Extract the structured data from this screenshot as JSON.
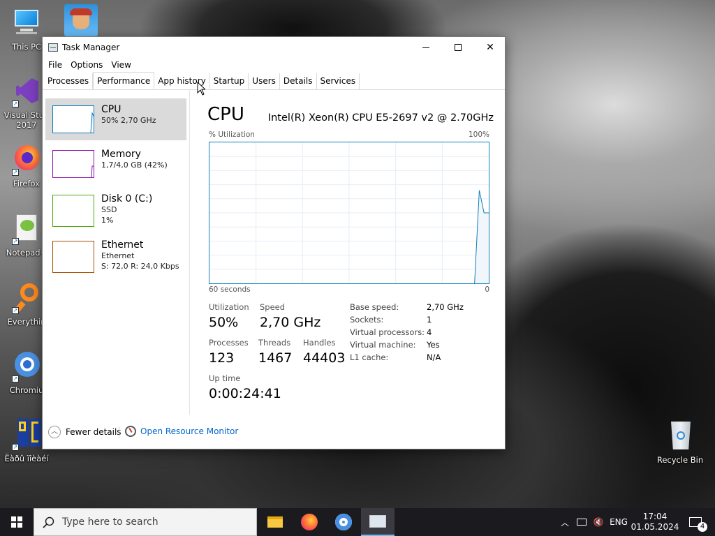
{
  "desktop": {
    "icons": [
      {
        "label": "This PC"
      },
      {
        "label": "Visual Stud\n2017"
      },
      {
        "label": "Firefox"
      },
      {
        "label": "Notepad+"
      },
      {
        "label": "Everythin"
      },
      {
        "label": "Chromiu"
      },
      {
        "label": "Ëàðû ïîèàéí"
      },
      {
        "label": "Recycle Bin"
      }
    ]
  },
  "window": {
    "title": "Task Manager",
    "menu": [
      "File",
      "Options",
      "View"
    ],
    "tabs": [
      "Processes",
      "Performance",
      "App history",
      "Startup",
      "Users",
      "Details",
      "Services"
    ],
    "active_tab": "Performance"
  },
  "resources": [
    {
      "name": "CPU",
      "sub1": "50% 2,70 GHz",
      "sub2": "",
      "color": "#117dbb"
    },
    {
      "name": "Memory",
      "sub1": "1,7/4,0 GB (42%)",
      "sub2": "",
      "color": "#8b12ae"
    },
    {
      "name": "Disk 0 (C:)",
      "sub1": "SSD",
      "sub2": "1%",
      "color": "#4da60c"
    },
    {
      "name": "Ethernet",
      "sub1": "Ethernet",
      "sub2": "S: 72,0  R: 24,0 Kbps",
      "color": "#a74f01"
    }
  ],
  "cpu": {
    "title": "CPU",
    "model": "Intel(R) Xeon(R) CPU E5-2697 v2 @ 2.70GHz",
    "y_label": "% Utilization",
    "y_max": "100%",
    "x_left": "60 seconds",
    "x_right": "0",
    "stats": {
      "utilization_label": "Utilization",
      "utilization": "50%",
      "speed_label": "Speed",
      "speed": "2,70 GHz",
      "processes_label": "Processes",
      "processes": "123",
      "threads_label": "Threads",
      "threads": "1467",
      "handles_label": "Handles",
      "handles": "44403",
      "uptime_label": "Up time",
      "uptime": "0:00:24:41"
    },
    "details": [
      {
        "k": "Base speed:",
        "v": "2,70 GHz"
      },
      {
        "k": "Sockets:",
        "v": "1"
      },
      {
        "k": "Virtual processors:",
        "v": "4"
      },
      {
        "k": "Virtual machine:",
        "v": "Yes"
      },
      {
        "k": "L1 cache:",
        "v": "N/A"
      }
    ],
    "history_percent": [
      0,
      0,
      0,
      0,
      0,
      0,
      0,
      0,
      0,
      0,
      0,
      0,
      0,
      0,
      0,
      0,
      0,
      0,
      0,
      0,
      0,
      0,
      0,
      0,
      0,
      0,
      0,
      0,
      0,
      0,
      0,
      0,
      0,
      0,
      0,
      0,
      0,
      0,
      0,
      0,
      0,
      0,
      0,
      0,
      0,
      0,
      0,
      0,
      0,
      0,
      0,
      0,
      0,
      0,
      0,
      0,
      0,
      66,
      50,
      50
    ]
  },
  "footer": {
    "fewer_details": "Fewer details",
    "open_resource_monitor": "Open Resource Monitor"
  },
  "taskbar": {
    "search_placeholder": "Type here to search",
    "language": "ENG",
    "time": "17:04",
    "date": "01.05.2024",
    "notifications": "4"
  }
}
